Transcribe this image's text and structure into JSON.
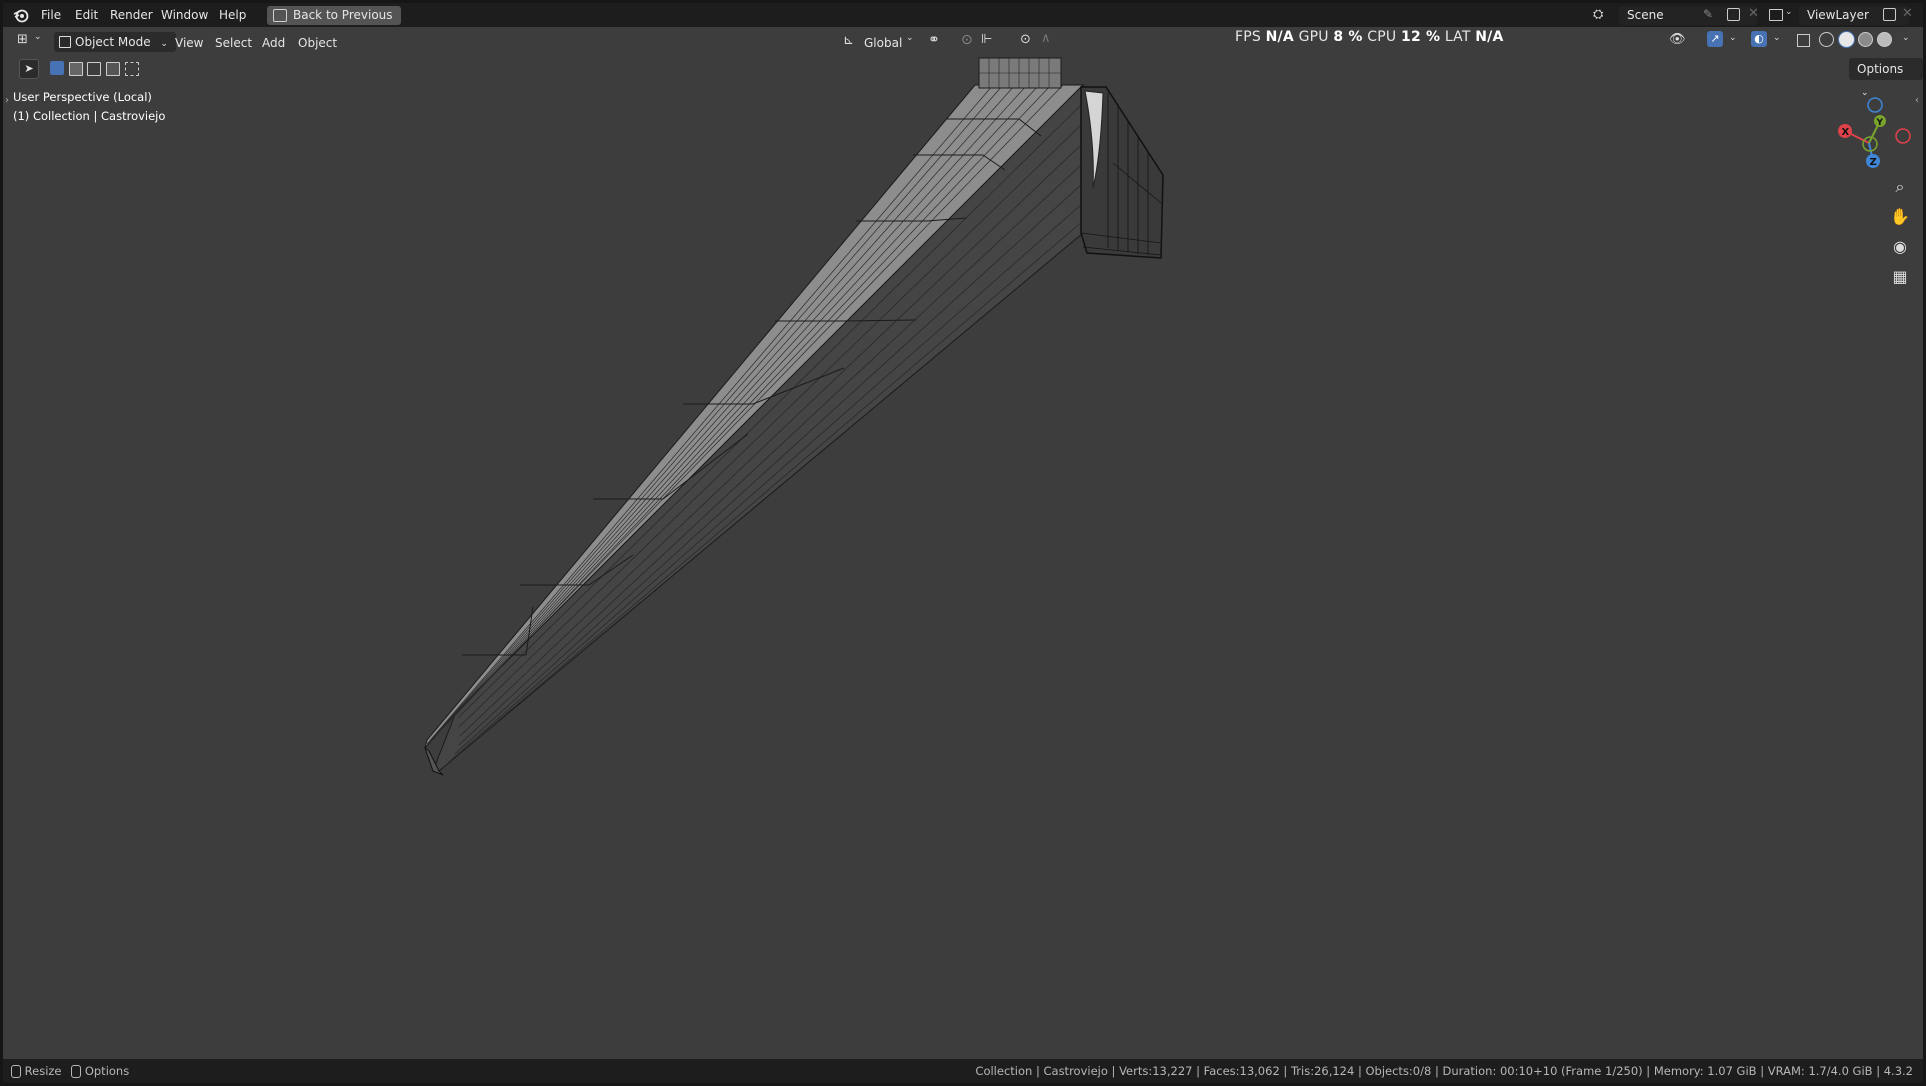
{
  "menubar": {
    "items": [
      "File",
      "Edit",
      "Render",
      "Window",
      "Help"
    ],
    "back_button": "Back to Previous",
    "scene": "Scene",
    "view_layer": "ViewLayer"
  },
  "header": {
    "mode": "Object Mode",
    "menus": [
      "View",
      "Select",
      "Add",
      "Object"
    ],
    "transform_orientation": "Global",
    "options": "Options"
  },
  "perf": {
    "fps_label": "FPS",
    "fps_value": "N/A",
    "gpu_label": "GPU",
    "gpu_value": "8 %",
    "cpu_label": "CPU",
    "cpu_value": "12 %",
    "lat_label": "LAT",
    "lat_value": "N/A"
  },
  "viewport": {
    "perspective": "User Perspective (Local)",
    "collection": "(1) Collection | Castroviejo"
  },
  "gizmo": {
    "x": "X",
    "y": "Y",
    "z": "Z"
  },
  "statusbar": {
    "left_resize": "Resize",
    "left_options": "Options",
    "info": "Collection | Castroviejo | Verts:13,227 | Faces:13,062 | Tris:26,124 | Objects:0/8 | Duration: 00:10+10 (Frame 1/250) | Memory: 1.07 GiB | VRAM: 1.7/4.0 GiB | 4.3.2"
  },
  "colors": {
    "x_axis": "#e0424b",
    "y_axis": "#7aa52d",
    "z_axis": "#3f86d6",
    "background": "#3d3d3d",
    "bar": "#1d1d1d"
  }
}
